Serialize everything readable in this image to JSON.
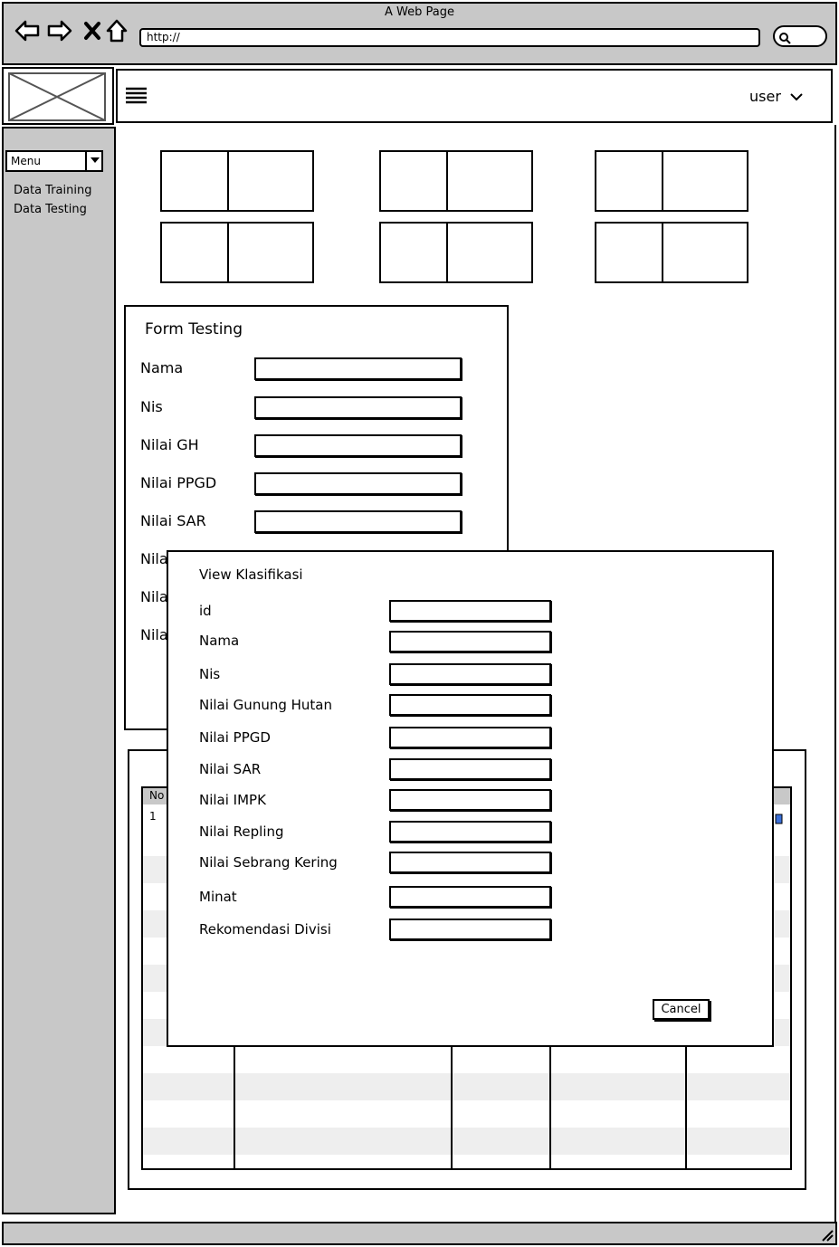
{
  "browser": {
    "window_title": "A Web Page",
    "url": "http://"
  },
  "header": {
    "user_label": "user"
  },
  "sidebar": {
    "menu_select": "Menu",
    "items": [
      {
        "label": "Data Training"
      },
      {
        "label": "Data Testing"
      }
    ]
  },
  "form_testing": {
    "title": "Form Testing",
    "fields": [
      {
        "label": "Nama",
        "value": ""
      },
      {
        "label": "Nis",
        "value": ""
      },
      {
        "label": "Nilai GH",
        "value": ""
      },
      {
        "label": "Nilai PPGD",
        "value": ""
      },
      {
        "label": "Nilai SAR",
        "value": ""
      },
      {
        "label": "Nila"
      },
      {
        "label": "Nila"
      },
      {
        "label": "Nila"
      }
    ]
  },
  "table": {
    "header_no": "No",
    "first_row_no": "1"
  },
  "dialog": {
    "title": "View Klasifikasi",
    "fields": [
      {
        "label": "id",
        "value": ""
      },
      {
        "label": "Nama",
        "value": ""
      },
      {
        "label": "Nis",
        "value": ""
      },
      {
        "label": "Nilai Gunung Hutan",
        "value": ""
      },
      {
        "label": "Nilai PPGD",
        "value": ""
      },
      {
        "label": "Nilai SAR",
        "value": ""
      },
      {
        "label": "Nilai IMPK",
        "value": ""
      },
      {
        "label": "Nilai Repling",
        "value": ""
      },
      {
        "label": "Nilai Sebrang Kering",
        "value": ""
      },
      {
        "label": "Minat",
        "value": ""
      },
      {
        "label": "Rekomendasi Divisi",
        "value": ""
      }
    ],
    "cancel_label": "Cancel"
  }
}
